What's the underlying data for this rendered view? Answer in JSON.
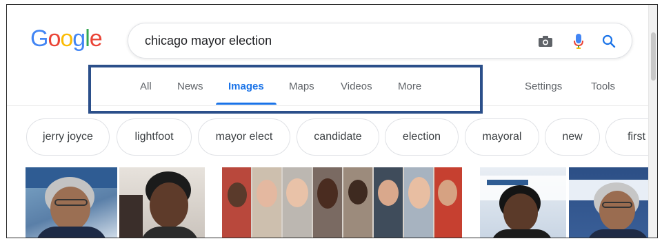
{
  "logo": {
    "letters": [
      "G",
      "o",
      "o",
      "g",
      "l",
      "e"
    ],
    "colors": [
      "#4285F4",
      "#EA4335",
      "#FBBC05",
      "#4285F4",
      "#34A853",
      "#EA4335"
    ]
  },
  "search": {
    "query": "chicago mayor election"
  },
  "icons": {
    "camera": "camera-icon",
    "mic": "microphone-icon",
    "search": "search-icon"
  },
  "tabs": {
    "items": [
      "All",
      "News",
      "Images",
      "Maps",
      "Videos",
      "More"
    ],
    "active": "Images",
    "settings": "Settings",
    "tools": "Tools"
  },
  "chips": [
    "jerry joyce",
    "lightfoot",
    "mayor elect",
    "candidate",
    "election",
    "mayoral",
    "new",
    "first"
  ],
  "colors": {
    "accent": "#1a73e8",
    "highlight_box": "#2b4f8a",
    "text_muted": "#5f6368"
  }
}
